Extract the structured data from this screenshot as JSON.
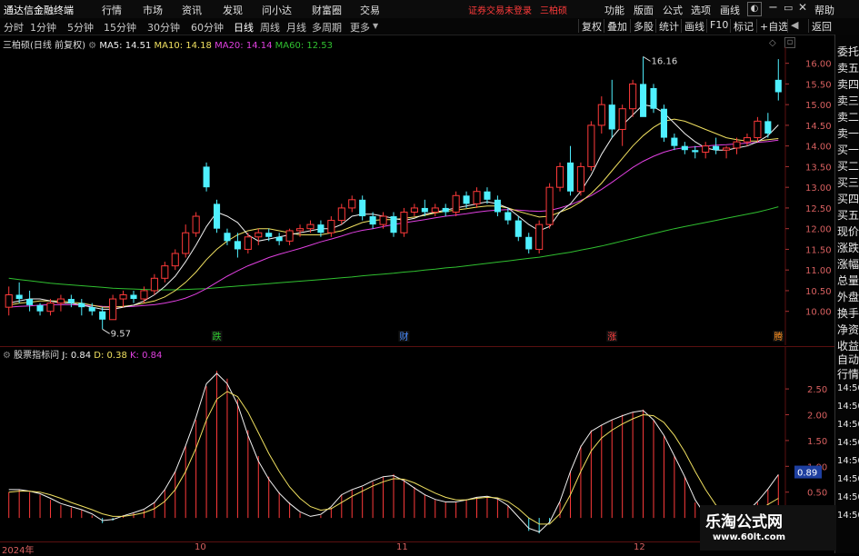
{
  "app": {
    "title": "通达信金融终端",
    "notice": "证券交易未登录",
    "stock": "三柏硕"
  },
  "menu": {
    "left": [
      "行情",
      "市场",
      "资讯",
      "发现",
      "问小达",
      "财富圈",
      "交易"
    ],
    "right": [
      "功能",
      "版面",
      "公式",
      "选项",
      "画线",
      "帮助"
    ]
  },
  "periods": [
    "分时",
    "1分钟",
    "5分钟",
    "15分钟",
    "30分钟",
    "60分钟",
    "日线",
    "周线",
    "月线",
    "多周期",
    "更多"
  ],
  "active_period": "日线",
  "toolbar": [
    "复权",
    "叠加",
    "多股",
    "统计",
    "画线",
    "F10",
    "标记",
    "+自选",
    "返回"
  ],
  "main_legend": {
    "name": "三柏硕(日线 前复权)",
    "ma5": "MA5: 14.51",
    "ma10": "MA10: 14.18",
    "ma20": "MA20: 14.14",
    "ma60": "MA60: 12.53"
  },
  "sub_legend": {
    "name": "股票指标问",
    "j": "J: 0.84",
    "d": "D: 0.38",
    "k": "K: 0.84"
  },
  "right_panel": [
    "委托",
    "卖五",
    "卖四",
    "卖三",
    "卖二",
    "卖一",
    "买一",
    "买二",
    "买三",
    "买四",
    "买五",
    "现价",
    "涨跌",
    "涨幅",
    "总量",
    "外盘",
    "换手",
    "净资",
    "收益",
    "自动",
    "行情",
    "14:50",
    "14:50",
    "14:50",
    "14:50",
    "14:50",
    "14:50",
    "14:50",
    "14:50"
  ],
  "xaxis_labels": [
    "2024年",
    "10",
    "11",
    "12"
  ],
  "markers": [
    "跌",
    "财",
    "涨",
    "腾"
  ],
  "watermark": {
    "line1": "乐淘公式网",
    "line2": "www.60lt.com"
  },
  "colors": {
    "up": "#ff3a3a",
    "down": "#4ff0ff",
    "ma5": "#f0f0f0",
    "ma10": "#f0e060",
    "ma20": "#e040e0",
    "ma60": "#30c030",
    "kdj_k": "#f0f0f0",
    "kdj_d": "#f0e060"
  },
  "chart_data": [
    {
      "type": "candlestick",
      "title": "三柏硕(日线 前复权)",
      "y_ticks": [
        "16.00",
        "15.50",
        "15.00",
        "14.50",
        "14.00",
        "13.50",
        "13.00",
        "12.50",
        "12.00",
        "11.50",
        "11.00",
        "10.50",
        "10.00"
      ],
      "ylim": [
        9.4,
        16.3
      ],
      "annotations": [
        {
          "label": "16.16",
          "value": 16.16
        },
        {
          "label": "9.57",
          "value": 9.57
        }
      ],
      "series_ohlc": [
        [
          10.1,
          10.6,
          9.9,
          10.4
        ],
        [
          10.4,
          10.7,
          10.2,
          10.3
        ],
        [
          10.3,
          10.5,
          10.0,
          10.15
        ],
        [
          10.15,
          10.2,
          9.9,
          10.0
        ],
        [
          10.0,
          10.3,
          9.9,
          10.2
        ],
        [
          10.2,
          10.4,
          10.0,
          10.3
        ],
        [
          10.3,
          10.4,
          10.1,
          10.2
        ],
        [
          10.2,
          10.3,
          9.9,
          10.1
        ],
        [
          10.1,
          10.2,
          9.9,
          10.0
        ],
        [
          10.0,
          10.1,
          9.57,
          9.8
        ],
        [
          9.8,
          10.4,
          9.8,
          10.3
        ],
        [
          10.3,
          10.5,
          10.1,
          10.4
        ],
        [
          10.4,
          10.5,
          10.2,
          10.3
        ],
        [
          10.3,
          10.6,
          10.2,
          10.5
        ],
        [
          10.5,
          10.9,
          10.4,
          10.8
        ],
        [
          10.8,
          11.2,
          10.7,
          11.1
        ],
        [
          11.1,
          11.5,
          11.0,
          11.4
        ],
        [
          11.4,
          12.1,
          11.3,
          11.9
        ],
        [
          11.9,
          12.4,
          11.8,
          12.3
        ],
        [
          13.5,
          13.6,
          12.9,
          13.0
        ],
        [
          12.6,
          12.7,
          11.9,
          12.0
        ],
        [
          11.9,
          12.0,
          11.6,
          11.7
        ],
        [
          11.7,
          11.9,
          11.3,
          11.5
        ],
        [
          11.5,
          11.9,
          11.4,
          11.8
        ],
        [
          11.8,
          12.0,
          11.6,
          11.9
        ],
        [
          11.9,
          12.0,
          11.7,
          11.8
        ],
        [
          11.8,
          11.9,
          11.6,
          11.7
        ],
        [
          11.7,
          12.0,
          11.6,
          11.95
        ],
        [
          11.95,
          12.1,
          11.8,
          12.0
        ],
        [
          12.0,
          12.2,
          11.9,
          12.1
        ],
        [
          12.1,
          12.2,
          11.8,
          11.9
        ],
        [
          11.9,
          12.3,
          11.8,
          12.2
        ],
        [
          12.2,
          12.6,
          12.1,
          12.5
        ],
        [
          12.5,
          12.8,
          12.4,
          12.7
        ],
        [
          12.7,
          12.8,
          12.2,
          12.3
        ],
        [
          12.3,
          12.4,
          12.0,
          12.1
        ],
        [
          12.1,
          12.4,
          12.0,
          12.3
        ],
        [
          12.3,
          12.4,
          11.8,
          11.9
        ],
        [
          11.9,
          12.5,
          11.8,
          12.4
        ],
        [
          12.4,
          12.6,
          12.3,
          12.5
        ],
        [
          12.5,
          12.7,
          12.3,
          12.4
        ],
        [
          12.4,
          12.6,
          12.3,
          12.5
        ],
        [
          12.5,
          12.6,
          12.3,
          12.4
        ],
        [
          12.4,
          12.9,
          12.3,
          12.8
        ],
        [
          12.8,
          12.9,
          12.5,
          12.6
        ],
        [
          12.6,
          13.0,
          12.5,
          12.9
        ],
        [
          12.9,
          13.0,
          12.6,
          12.7
        ],
        [
          12.7,
          12.8,
          12.3,
          12.4
        ],
        [
          12.4,
          12.5,
          12.1,
          12.2
        ],
        [
          12.2,
          12.3,
          11.7,
          11.8
        ],
        [
          11.8,
          11.9,
          11.4,
          11.5
        ],
        [
          11.5,
          12.2,
          11.4,
          12.1
        ],
        [
          12.1,
          13.1,
          12.0,
          13.0
        ],
        [
          13.0,
          13.6,
          12.9,
          13.5
        ],
        [
          13.6,
          14.0,
          12.8,
          12.9
        ],
        [
          12.9,
          13.6,
          12.8,
          13.5
        ],
        [
          13.5,
          14.6,
          13.4,
          14.5
        ],
        [
          14.5,
          15.2,
          14.3,
          15.0
        ],
        [
          15.0,
          15.6,
          14.2,
          14.4
        ],
        [
          14.4,
          15.0,
          14.0,
          14.9
        ],
        [
          14.9,
          15.6,
          14.7,
          15.5
        ],
        [
          15.5,
          16.16,
          15.0,
          14.7
        ],
        [
          15.4,
          15.5,
          14.8,
          14.9
        ],
        [
          14.9,
          15.0,
          14.1,
          14.2
        ],
        [
          14.2,
          14.3,
          13.9,
          14.0
        ],
        [
          14.0,
          14.1,
          13.8,
          13.9
        ],
        [
          13.9,
          14.0,
          13.7,
          13.85
        ],
        [
          13.85,
          14.1,
          13.7,
          14.0
        ],
        [
          14.0,
          14.2,
          13.8,
          13.9
        ],
        [
          13.9,
          14.0,
          13.7,
          13.95
        ],
        [
          13.95,
          14.2,
          13.8,
          14.1
        ],
        [
          14.1,
          14.3,
          14.0,
          14.2
        ],
        [
          14.2,
          14.7,
          14.1,
          14.6
        ],
        [
          14.6,
          14.8,
          14.2,
          14.3
        ],
        [
          15.6,
          16.1,
          15.1,
          15.3
        ]
      ],
      "ma_series": [
        {
          "name": "MA5",
          "values": [
            10.2,
            10.25,
            10.3,
            10.3,
            10.25,
            10.2,
            10.2,
            10.15,
            10.1,
            10.05,
            10.05,
            10.1,
            10.15,
            10.25,
            10.4,
            10.6,
            10.85,
            11.2,
            11.6,
            12.05,
            12.4,
            12.3,
            12.15,
            11.85,
            11.7,
            11.75,
            11.8,
            11.85,
            11.9,
            11.95,
            12.0,
            12.0,
            12.1,
            12.3,
            12.35,
            12.35,
            12.3,
            12.25,
            12.2,
            12.25,
            12.35,
            12.4,
            12.45,
            12.5,
            12.55,
            12.6,
            12.65,
            12.6,
            12.5,
            12.3,
            12.1,
            11.95,
            12.05,
            12.4,
            12.6,
            12.9,
            13.3,
            13.8,
            14.2,
            14.5,
            14.75,
            15.0,
            14.95,
            14.8,
            14.55,
            14.3,
            14.1,
            13.95,
            13.9,
            13.9,
            13.95,
            14.0,
            14.1,
            14.25,
            14.51
          ]
        },
        {
          "name": "MA10",
          "values": [
            10.15,
            10.2,
            10.22,
            10.25,
            10.25,
            10.25,
            10.22,
            10.2,
            10.15,
            10.1,
            10.1,
            10.12,
            10.15,
            10.2,
            10.25,
            10.35,
            10.5,
            10.7,
            10.95,
            11.25,
            11.5,
            11.7,
            11.85,
            11.95,
            12.0,
            12.0,
            11.95,
            11.9,
            11.85,
            11.85,
            11.85,
            11.9,
            11.95,
            12.05,
            12.15,
            12.2,
            12.22,
            12.22,
            12.25,
            12.28,
            12.32,
            12.38,
            12.42,
            12.45,
            12.48,
            12.52,
            12.55,
            12.55,
            12.5,
            12.42,
            12.35,
            12.28,
            12.3,
            12.4,
            12.5,
            12.65,
            12.85,
            13.1,
            13.4,
            13.7,
            14.0,
            14.25,
            14.45,
            14.6,
            14.65,
            14.6,
            14.5,
            14.4,
            14.3,
            14.2,
            14.15,
            14.12,
            14.12,
            14.15,
            14.18
          ]
        },
        {
          "name": "MA20",
          "values": [
            10.1,
            10.12,
            10.13,
            10.15,
            10.16,
            10.16,
            10.16,
            10.15,
            10.14,
            10.12,
            10.11,
            10.11,
            10.12,
            10.14,
            10.16,
            10.2,
            10.25,
            10.32,
            10.42,
            10.55,
            10.7,
            10.85,
            10.98,
            11.1,
            11.2,
            11.3,
            11.38,
            11.45,
            11.52,
            11.6,
            11.68,
            11.75,
            11.82,
            11.9,
            11.96,
            12.0,
            12.05,
            12.1,
            12.14,
            12.18,
            12.22,
            12.26,
            12.3,
            12.33,
            12.36,
            12.4,
            12.43,
            12.45,
            12.46,
            12.45,
            12.43,
            12.42,
            12.44,
            12.5,
            12.58,
            12.68,
            12.8,
            12.95,
            13.12,
            13.3,
            13.48,
            13.63,
            13.75,
            13.85,
            13.92,
            13.96,
            13.98,
            14.0,
            14.02,
            14.03,
            14.05,
            14.07,
            14.09,
            14.11,
            14.14
          ]
        },
        {
          "name": "MA60",
          "values": [
            10.8,
            10.77,
            10.74,
            10.71,
            10.68,
            10.66,
            10.64,
            10.62,
            10.6,
            10.58,
            10.56,
            10.55,
            10.54,
            10.53,
            10.52,
            10.52,
            10.52,
            10.53,
            10.54,
            10.55,
            10.57,
            10.59,
            10.61,
            10.63,
            10.65,
            10.67,
            10.69,
            10.71,
            10.73,
            10.75,
            10.77,
            10.79,
            10.81,
            10.83,
            10.86,
            10.88,
            10.9,
            10.92,
            10.95,
            10.97,
            11.0,
            11.02,
            11.05,
            11.07,
            11.1,
            11.13,
            11.16,
            11.19,
            11.22,
            11.25,
            11.28,
            11.31,
            11.35,
            11.39,
            11.43,
            11.48,
            11.53,
            11.58,
            11.64,
            11.7,
            11.76,
            11.82,
            11.88,
            11.94,
            12.0,
            12.05,
            12.1,
            12.15,
            12.2,
            12.25,
            12.3,
            12.35,
            12.4,
            12.46,
            12.53
          ]
        }
      ]
    },
    {
      "type": "line",
      "title": "股票指标问",
      "y_ticks": [
        "2.50",
        "2.00",
        "1.50",
        "1.00",
        "0.50",
        "0.00"
      ],
      "ylim": [
        -0.35,
        3.1
      ],
      "current_marker": "0.89",
      "bars": [
        0.5,
        0.55,
        0.5,
        0.45,
        0.35,
        0.25,
        0.2,
        0.15,
        0.05,
        -0.1,
        -0.05,
        0.05,
        0.1,
        0.15,
        0.3,
        0.55,
        0.9,
        1.4,
        1.9,
        2.55,
        2.85,
        2.7,
        2.3,
        1.7,
        1.2,
        0.8,
        0.5,
        0.3,
        0.1,
        0.0,
        0.05,
        0.2,
        0.45,
        0.55,
        0.6,
        0.7,
        0.8,
        0.85,
        0.75,
        0.6,
        0.45,
        0.35,
        0.3,
        0.3,
        0.35,
        0.4,
        0.42,
        0.38,
        0.25,
        0.0,
        -0.25,
        -0.3,
        -0.1,
        0.3,
        0.9,
        1.4,
        1.7,
        1.8,
        1.9,
        2.0,
        2.05,
        2.1,
        1.9,
        1.6,
        1.2,
        0.8,
        0.3,
        0.0,
        -0.15,
        -0.2,
        -0.1,
        0.1,
        0.3,
        0.55,
        0.84
      ],
      "series": [
        {
          "name": "K",
          "values": [
            0.55,
            0.55,
            0.52,
            0.47,
            0.38,
            0.28,
            0.22,
            0.16,
            0.08,
            -0.05,
            -0.03,
            0.04,
            0.1,
            0.17,
            0.3,
            0.55,
            0.9,
            1.4,
            1.95,
            2.6,
            2.8,
            2.6,
            2.2,
            1.6,
            1.1,
            0.75,
            0.48,
            0.28,
            0.12,
            0.03,
            0.07,
            0.22,
            0.45,
            0.55,
            0.62,
            0.72,
            0.8,
            0.82,
            0.72,
            0.58,
            0.45,
            0.36,
            0.31,
            0.31,
            0.35,
            0.4,
            0.42,
            0.37,
            0.24,
            0.02,
            -0.2,
            -0.27,
            -0.08,
            0.32,
            0.9,
            1.38,
            1.68,
            1.8,
            1.9,
            1.98,
            2.05,
            2.08,
            1.9,
            1.6,
            1.2,
            0.8,
            0.35,
            0.05,
            -0.12,
            -0.18,
            -0.08,
            0.12,
            0.32,
            0.56,
            0.84
          ]
        },
        {
          "name": "D",
          "values": [
            0.5,
            0.52,
            0.52,
            0.5,
            0.45,
            0.38,
            0.3,
            0.23,
            0.16,
            0.08,
            0.03,
            0.03,
            0.06,
            0.1,
            0.18,
            0.32,
            0.55,
            0.9,
            1.35,
            1.9,
            2.3,
            2.45,
            2.35,
            2.05,
            1.65,
            1.25,
            0.9,
            0.6,
            0.38,
            0.22,
            0.15,
            0.18,
            0.3,
            0.42,
            0.52,
            0.62,
            0.7,
            0.76,
            0.75,
            0.68,
            0.58,
            0.48,
            0.4,
            0.35,
            0.35,
            0.38,
            0.4,
            0.39,
            0.32,
            0.18,
            0.0,
            -0.12,
            -0.12,
            0.08,
            0.45,
            0.9,
            1.3,
            1.55,
            1.7,
            1.82,
            1.92,
            2.0,
            1.98,
            1.85,
            1.6,
            1.28,
            0.9,
            0.55,
            0.25,
            0.05,
            -0.05,
            0.0,
            0.12,
            0.26,
            0.38
          ]
        }
      ]
    }
  ]
}
